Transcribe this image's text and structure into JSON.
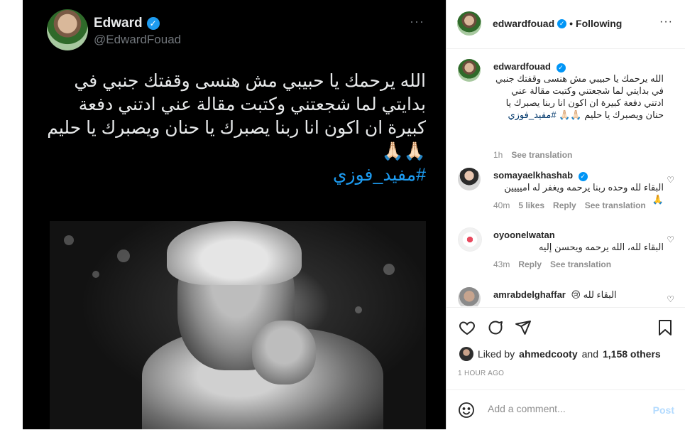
{
  "tweet": {
    "name": "Edward",
    "handle": "@EdwardFouad",
    "more": "···",
    "text": "الله يرحمك يا حبيبي مش هنسى وقفتك جنبي في بدايتي لما شجعتني وكتبت مقالة عني ادتني دفعة كبيرة ان اكون انا ربنا يصبرك يا حنان ويصبرك يا حليم 🙏🏻🙏🏻",
    "hashtag": "#مفيد_فوزي"
  },
  "header": {
    "username": "edwardfouad",
    "dot": "•",
    "follow_status": "Following",
    "more": "···"
  },
  "caption": {
    "username": "edwardfouad",
    "text": "الله يرحمك يا حبيبي مش هنسى وقفتك جنبي في بدايتي لما شجعتني وكتبت مقالة عني ادتني دفعة كبيرة ان اكون انا ربنا يصبرك يا حنان ويصبرك يا حليم 🙏🏻🙏🏻",
    "hashtag": "#مفيد_فوزي",
    "time": "1h",
    "see_translation": "See translation"
  },
  "comments": [
    {
      "username": "somayaelkhashab",
      "verified": true,
      "text": "البقاء لله وحده ربنا يرحمه ويغفر له اميييين 🙏",
      "time": "40m",
      "likes": "5 likes",
      "reply": "Reply",
      "see_translation": "See translation"
    },
    {
      "username": "oyoonelwatan",
      "verified": false,
      "text": "البقاء لله، الله يرحمه ويحسن إليه",
      "time": "43m",
      "reply": "Reply",
      "see_translation": "See translation"
    },
    {
      "username": "amrabdelghaffar",
      "verified": false,
      "text": "البقاء لله 😢"
    }
  ],
  "likes": {
    "prefix": "Liked by",
    "user": "ahmedcooty",
    "and": "and",
    "others": "1,158 others"
  },
  "timestamp": "1 HOUR AGO",
  "add_comment": {
    "placeholder": "Add a comment...",
    "post_label": "Post"
  },
  "colors": {
    "verified_instagram": "#0095f6",
    "verified_twitter": "#1d9bf0",
    "hashtag_twitter": "#1d9bf0",
    "hashtag_instagram": "#00376b",
    "post_disabled": "#b3dbff"
  },
  "icons": [
    "verified-icon",
    "more-icon",
    "heart-icon",
    "comment-icon",
    "share-icon",
    "bookmark-icon",
    "emoji-icon",
    "prayer-hands-icon",
    "sad-face-icon"
  ]
}
